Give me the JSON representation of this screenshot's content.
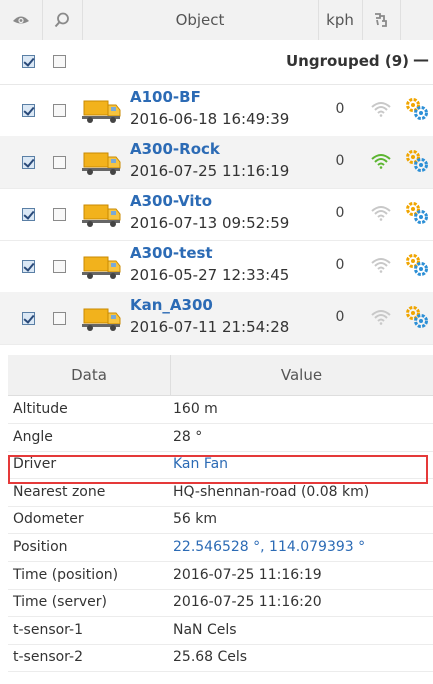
{
  "header": {
    "object_label": "Object",
    "speed_label": "kph",
    "visibility_icon": "eye-icon",
    "follow_icon": "search-icon",
    "connection_icon": "connection-icon"
  },
  "group": {
    "label": "Ungrouped (9)",
    "collapse_symbol": "—"
  },
  "objects": [
    {
      "name": "A100-BF",
      "time": "2016-06-18 16:49:39",
      "speed": "0",
      "signal": "gray",
      "visible": true,
      "followed": false,
      "alt": false
    },
    {
      "name": "A300-Rock",
      "time": "2016-07-25 11:16:19",
      "speed": "0",
      "signal": "green",
      "visible": true,
      "followed": false,
      "alt": true
    },
    {
      "name": "A300-Vito",
      "time": "2016-07-13 09:52:59",
      "speed": "0",
      "signal": "gray",
      "visible": true,
      "followed": false,
      "alt": false
    },
    {
      "name": "A300-test",
      "time": "2016-05-27 12:33:45",
      "speed": "0",
      "signal": "gray",
      "visible": true,
      "followed": false,
      "alt": false
    },
    {
      "name": "Kan_A300",
      "time": "2016-07-11 21:54:28",
      "speed": "0",
      "signal": "gray",
      "visible": true,
      "followed": false,
      "alt": true
    }
  ],
  "details": {
    "col_data": "Data",
    "col_value": "Value",
    "rows": [
      {
        "key": "Altitude",
        "value": "160 m",
        "link": false
      },
      {
        "key": "Angle",
        "value": "28 °",
        "link": false
      },
      {
        "key": "Driver",
        "value": "Kan Fan",
        "link": true
      },
      {
        "key": "Nearest zone",
        "value": "HQ-shennan-road (0.08 km)",
        "link": false
      },
      {
        "key": "Odometer",
        "value": "56 km",
        "link": false
      },
      {
        "key": "Position",
        "value": "22.546528 °, 114.079393 °",
        "link": true
      },
      {
        "key": "Time (position)",
        "value": "2016-07-25 11:16:19",
        "link": false
      },
      {
        "key": "Time (server)",
        "value": "2016-07-25 11:16:20",
        "link": false
      },
      {
        "key": "t-sensor-1",
        "value": "NaN Cels",
        "link": false
      },
      {
        "key": "t-sensor-2",
        "value": "25.68 Cels",
        "link": false
      }
    ]
  },
  "colors": {
    "link": "#2c6bb5",
    "signal_green": "#5cb531",
    "signal_gray": "#c8c8c8",
    "gear_orange": "#f0a500",
    "gear_blue": "#2c8fd6",
    "highlight": "#e53939"
  }
}
